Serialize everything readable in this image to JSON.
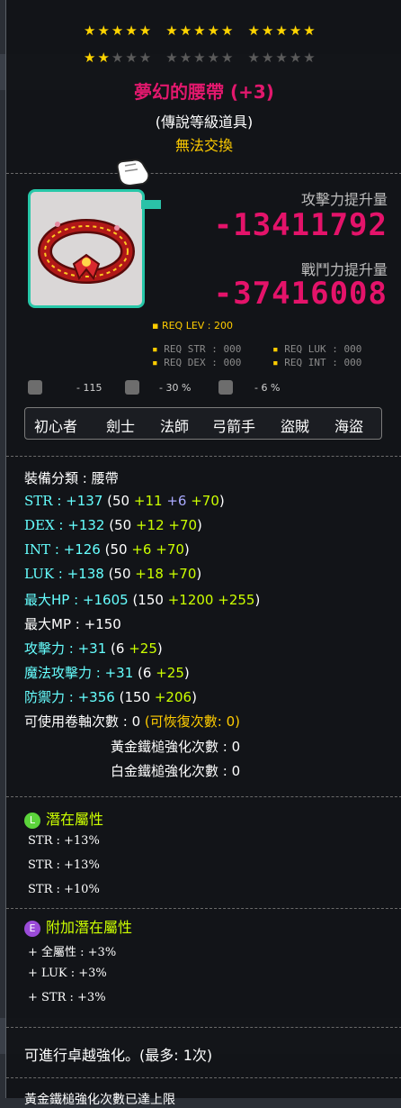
{
  "stars": {
    "filled": 2,
    "total": 25
  },
  "item": {
    "name": "夢幻的腰帶 (+3)",
    "grade": "(傳說等級道具)",
    "trade": "無法交換"
  },
  "compare": {
    "attack_label": "攻擊力提升量",
    "attack_value": "-13411792",
    "power_label": "戰鬥力提升量",
    "power_value": "-37416008"
  },
  "requirements": {
    "level": "REQ LEV : 200",
    "str": "REQ STR : 000",
    "luk": "REQ LUK : 000",
    "dex": "REQ DEX : 000",
    "int": "REQ INT : 000"
  },
  "modifiers": {
    "first": "- 115",
    "second": "- 30 %",
    "third": "- 6 %"
  },
  "jobs": [
    "初心者",
    "劍士",
    "法師",
    "弓箭手",
    "盜賊",
    "海盜"
  ],
  "category": "裝備分類 : 腰帶",
  "stats": [
    {
      "name": "STR",
      "sep": " : ",
      "total": "+137",
      "base": "(50 ",
      "a": "+11",
      "b": "+6",
      "c": "+70",
      "end": ")"
    },
    {
      "name": "DEX",
      "sep": " : ",
      "total": "+132",
      "base": "(50 ",
      "a": "+12",
      "c": "+70",
      "end": ")"
    },
    {
      "name": "INT",
      "sep": " : ",
      "total": "+126",
      "base": "(50 ",
      "a": "+6",
      "c": "+70",
      "end": ")"
    },
    {
      "name": "LUK",
      "sep": " : ",
      "total": "+138",
      "base": "(50 ",
      "a": "+18",
      "c": "+70",
      "end": ")"
    },
    {
      "name": "最大HP",
      "sep": " : ",
      "total": "+1605",
      "base": "(150 ",
      "a": "+1200",
      "c": "+255",
      "end": ")"
    },
    {
      "name": "最大MP",
      "sep": " : ",
      "total": "+150"
    },
    {
      "name": "攻擊力",
      "sep": " : ",
      "total": "+31",
      "base": "(6 ",
      "c": "+25",
      "end": ")"
    },
    {
      "name": "魔法攻擊力",
      "sep": " : ",
      "total": "+31",
      "base": "(6 ",
      "c": "+25",
      "end": ")"
    },
    {
      "name": "防禦力",
      "sep": " : ",
      "total": "+356",
      "base": "(150 ",
      "c": "+206",
      "end": ")"
    }
  ],
  "scroll": {
    "label": "可使用卷軸次數 : 0 ",
    "recover": "(可恢復次數: 0)"
  },
  "hammer_gold": "黃金鐵槌強化次數 : 0",
  "hammer_plat": "白金鐵槌強化次數 : 0",
  "potential": {
    "badge": "L",
    "title": "潛在屬性",
    "color": "#5bd43b",
    "lines": [
      "STR : +13%",
      "STR : +13%",
      "STR : +10%"
    ]
  },
  "bonus_potential": {
    "badge": "E",
    "title": "附加潛在屬性",
    "color": "#9a4bd8",
    "lines": [
      "+ 全屬性 : +3%",
      "+ LUK : +3%",
      "+ STR : +3%"
    ]
  },
  "footer": "可進行卓越強化。(最多: 1次)",
  "footer_cut": "黃金鐵槌強化次數已達上限"
}
